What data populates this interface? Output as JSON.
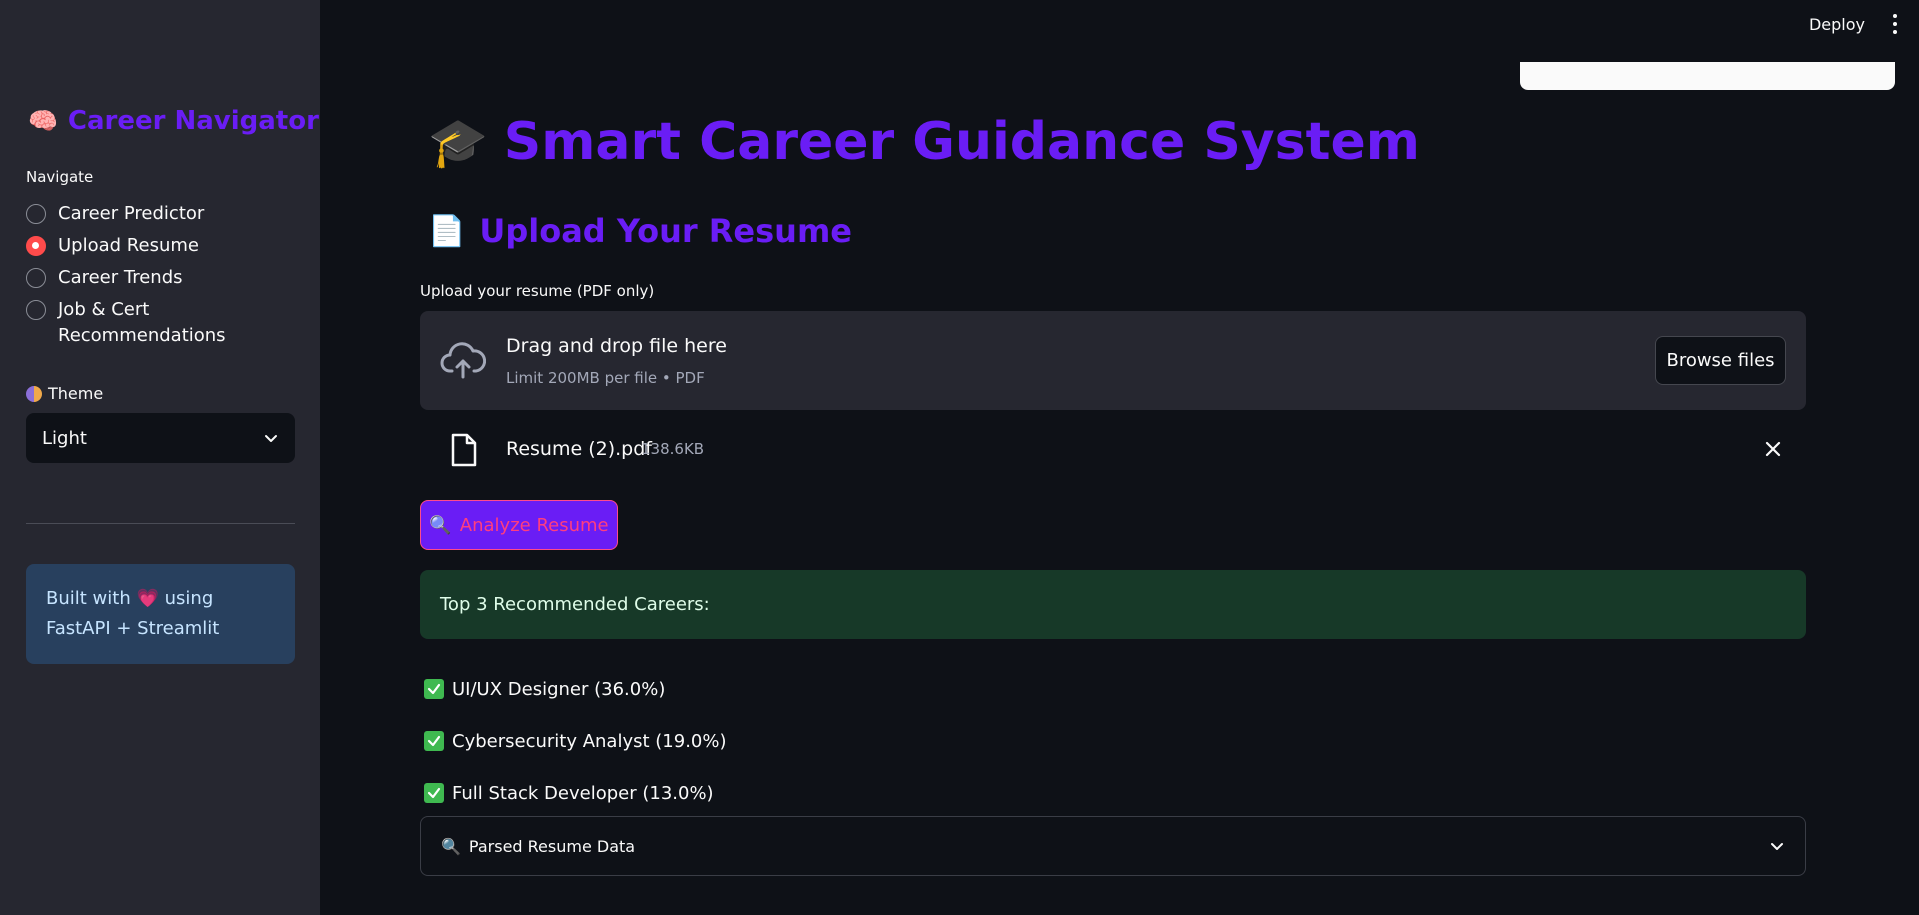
{
  "sidebar": {
    "brand_emoji": "🧠",
    "brand_title": "Career Navigator",
    "nav_label": "Navigate",
    "nav_items": [
      {
        "label": "Career Predictor",
        "checked": false
      },
      {
        "label": "Upload Resume",
        "checked": true
      },
      {
        "label": "Career Trends",
        "checked": false
      },
      {
        "label": "Job & Cert Recommendations",
        "checked": false
      }
    ],
    "theme_label": "Theme",
    "theme_value": "Light",
    "info_text_1": "Built with",
    "info_heart": "💗",
    "info_text_2": "using FastAPI + Streamlit"
  },
  "header": {
    "deploy_label": "Deploy"
  },
  "main": {
    "title_emoji": "🎓",
    "title": "Smart Career Guidance System",
    "section_emoji": "📄",
    "section_title": "Upload Your Resume",
    "upload_label": "Upload your resume (PDF only)",
    "dropzone_title": "Drag and drop file here",
    "dropzone_sub": "Limit 200MB per file • PDF",
    "browse_label": "Browse files",
    "file_name": "Resume (2).pdf",
    "file_size": "138.6KB",
    "analyze_emoji": "🔍",
    "analyze_label": "Analyze Resume",
    "success_text": "Top 3 Recommended Careers:",
    "careers": [
      "UI/UX Designer (36.0%)",
      "Cybersecurity Analyst (19.0%)",
      "Full Stack Developer (13.0%)"
    ],
    "expander_emoji": "🔍",
    "expander_label": "Parsed Resume Data"
  },
  "colors": {
    "accent_purple": "#6a1df5",
    "radio_active": "#ff4b4b",
    "success_bg": "#173928",
    "info_bg": "#28405e"
  }
}
